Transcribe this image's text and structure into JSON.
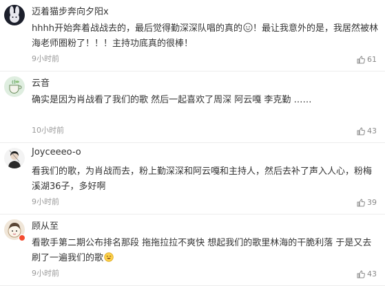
{
  "comments": [
    {
      "username": "迈着猫步奔向夕阳x",
      "text_line1": "hhhh开始奔着战战去的，最后觉得勤深深队唱的真的",
      "text_after_emoji": "！最让我意外的是，我居然被林海老师圈粉了！！！主持功底真的很棒！",
      "time": "9小时前",
      "likes": "61",
      "avatar_icon": "bunny-avatar-icon"
    },
    {
      "username": "云音",
      "text": "确实是因为肖战看了我们的歌 然后一起喜欢了周深 阿云嘎 李克勤 ……",
      "time": "10小时前",
      "likes": "43",
      "avatar_icon": "tea-avatar-icon"
    },
    {
      "username": "Joyceeeo-o",
      "text": "看我们的歌，为肖战而去，粉上勤深深和阿云嘎和主持人，然后去补了声入人心，粉梅溪湖36子，多好啊",
      "time": "9小时前",
      "likes": "39",
      "avatar_icon": "person-avatar-icon"
    },
    {
      "username": "顾从至",
      "text": "看歌手第二期公布排名那段 拖拖拉拉不爽快 想起我们的歌里林海的干脆利落 于是又去刷了一遍我们的歌",
      "time": "9小时前",
      "likes": "43",
      "avatar_icon": "cartoon-avatar-icon"
    }
  ],
  "colors": {
    "username": "#333333",
    "time": "#999999",
    "divider": "#ececec",
    "badge": "#f34b2e"
  }
}
